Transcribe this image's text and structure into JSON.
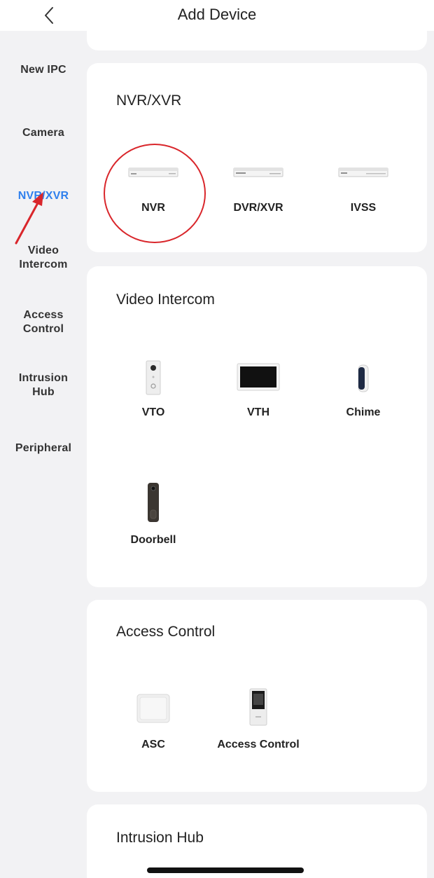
{
  "header": {
    "title": "Add Device",
    "back_icon": "chevron-left-icon"
  },
  "sidebar": {
    "items": [
      {
        "label": "New IPC"
      },
      {
        "label": "Camera"
      },
      {
        "label": "NVR/XVR",
        "active": true
      },
      {
        "label": "Video\nIntercom"
      },
      {
        "label": "Access\nControl"
      },
      {
        "label": "Intrusion\nHub"
      },
      {
        "label": "Peripheral"
      }
    ],
    "active_color": "#2f80ed"
  },
  "sections": {
    "nvr": {
      "title": "NVR/XVR",
      "devices": [
        {
          "label": "NVR"
        },
        {
          "label": "DVR/XVR"
        },
        {
          "label": "IVSS"
        }
      ]
    },
    "intercom": {
      "title": "Video Intercom",
      "devices": [
        {
          "label": "VTO"
        },
        {
          "label": "VTH"
        },
        {
          "label": "Chime"
        },
        {
          "label": "Doorbell"
        }
      ]
    },
    "access": {
      "title": "Access Control",
      "devices": [
        {
          "label": "ASC"
        },
        {
          "label": "Access Control"
        }
      ]
    },
    "intrusion": {
      "title": "Intrusion Hub"
    }
  },
  "annotation_color": "#d9262b"
}
